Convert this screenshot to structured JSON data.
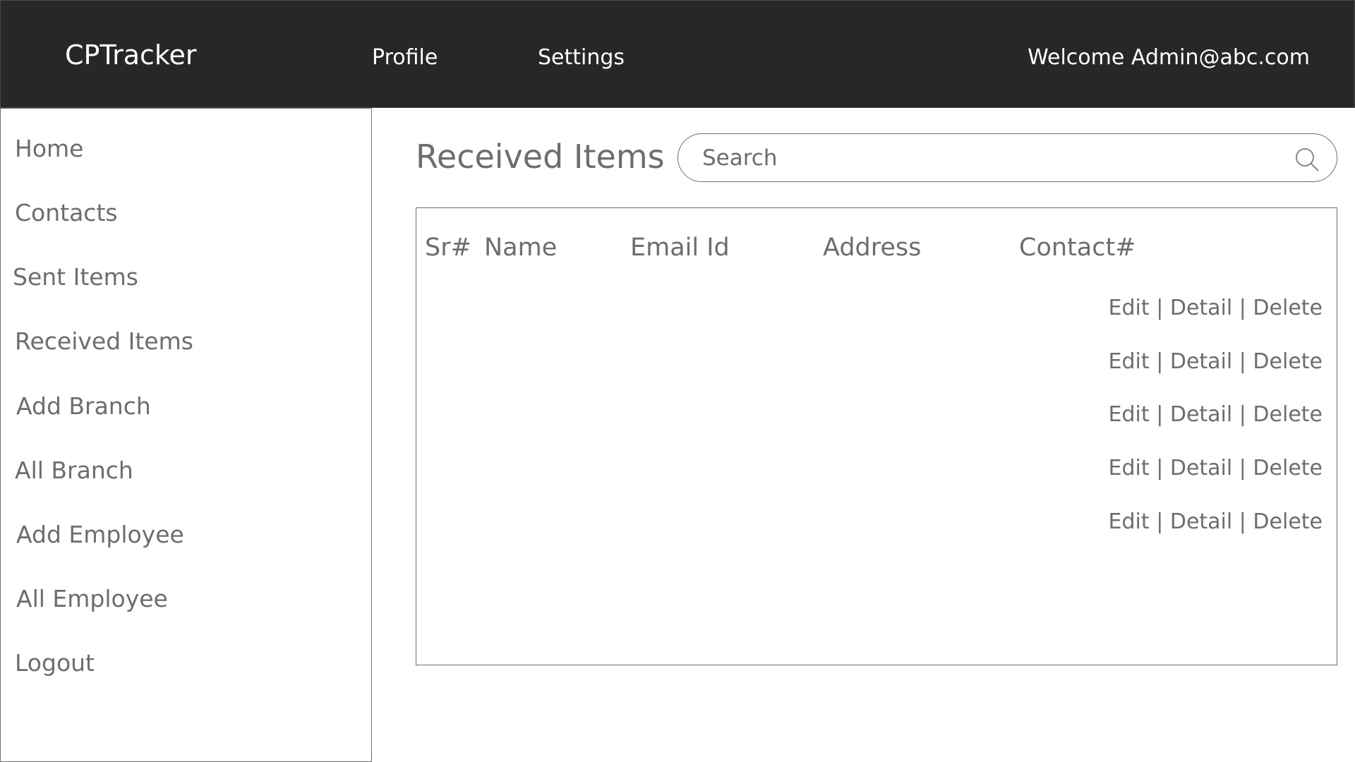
{
  "header": {
    "brand": "CPTracker",
    "nav": [
      {
        "label": "Profile"
      },
      {
        "label": "Settings"
      }
    ],
    "welcome": "Welcome Admin@abc.com"
  },
  "sidebar": {
    "items": [
      {
        "label": "Home"
      },
      {
        "label": "Contacts"
      },
      {
        "label": "Sent Items"
      },
      {
        "label": "Received Items"
      },
      {
        "label": "Add Branch"
      },
      {
        "label": "All Branch"
      },
      {
        "label": "Add Employee"
      },
      {
        "label": "All Employee"
      },
      {
        "label": "Logout"
      }
    ]
  },
  "main": {
    "title": "Received Items",
    "search": {
      "placeholder": "Search",
      "value": "",
      "icon": "search-icon"
    },
    "table": {
      "columns": [
        "Sr#",
        "Name",
        "Email Id",
        "Address",
        "Contact#"
      ],
      "rows": [
        {
          "edit": "Edit",
          "sep1": "|",
          "detail": "Detail",
          "sep2": "|",
          "delete": "Delete"
        },
        {
          "edit": "Edit",
          "sep1": "|",
          "detail": "Detail",
          "sep2": "|",
          "delete": "Delete"
        },
        {
          "edit": "Edit",
          "sep1": "|",
          "detail": "Detail",
          "sep2": "|",
          "delete": "Delete"
        },
        {
          "edit": "Edit",
          "sep1": "|",
          "detail": "Detail",
          "sep2": "|",
          "delete": "Delete"
        },
        {
          "edit": "Edit",
          "sep1": "|",
          "detail": "Detail",
          "sep2": "|",
          "delete": "Delete"
        }
      ]
    }
  },
  "colors": {
    "header_bg": "#282725",
    "text": "#6d6d6d",
    "border": "#6f6f6f"
  }
}
